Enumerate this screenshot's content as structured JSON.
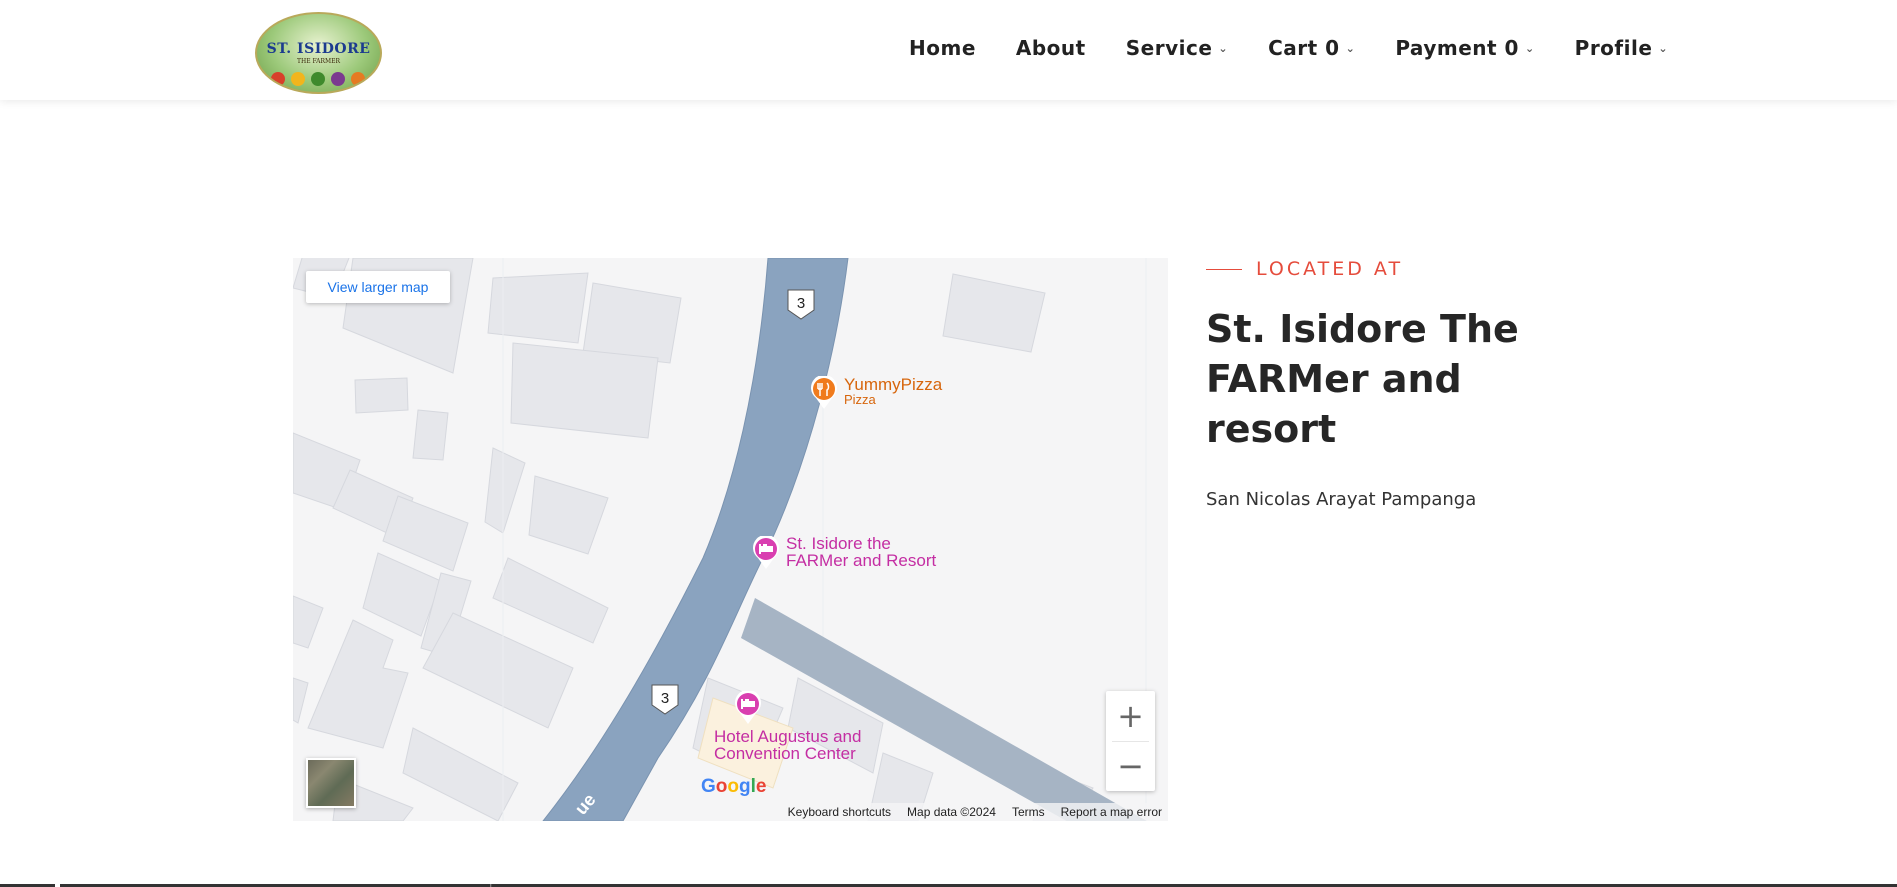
{
  "logo": {
    "text": "ST. ISIDORE",
    "subtext": "THE FARMER"
  },
  "nav": {
    "items": [
      {
        "label": "Home",
        "dropdown": false
      },
      {
        "label": "About",
        "dropdown": false
      },
      {
        "label": "Service",
        "dropdown": true
      },
      {
        "label": "Cart 0",
        "dropdown": true
      },
      {
        "label": "Payment 0",
        "dropdown": true
      },
      {
        "label": "Profile",
        "dropdown": true
      }
    ]
  },
  "map": {
    "view_larger": "View larger map",
    "route_shield": "3",
    "pois": {
      "pizza_name": "YummyPizza",
      "pizza_type": "Pizza",
      "resort_line1": "St. Isidore the",
      "resort_line2": "FARMer and Resort",
      "hotel_line1": "Hotel Augustus and",
      "hotel_line2": "Convention Center"
    },
    "zoom_in": "+",
    "zoom_out": "−",
    "google": "Google",
    "footer": {
      "shortcuts": "Keyboard shortcuts",
      "map_data": "Map data ©2024",
      "terms": "Terms",
      "report": "Report a map error"
    },
    "colors": {
      "road": "#8aa3bf",
      "road_secondary": "#a6b4c4",
      "building": "#e6e7eb",
      "poi_food": "#f07b1d",
      "poi_lodging": "#d93fb0"
    }
  },
  "info": {
    "kicker": "LOCATED AT",
    "title": "St. Isidore The FARMer and resort",
    "address": "San Nicolas Arayat Pampanga",
    "accent_color": "#e54c3c"
  }
}
